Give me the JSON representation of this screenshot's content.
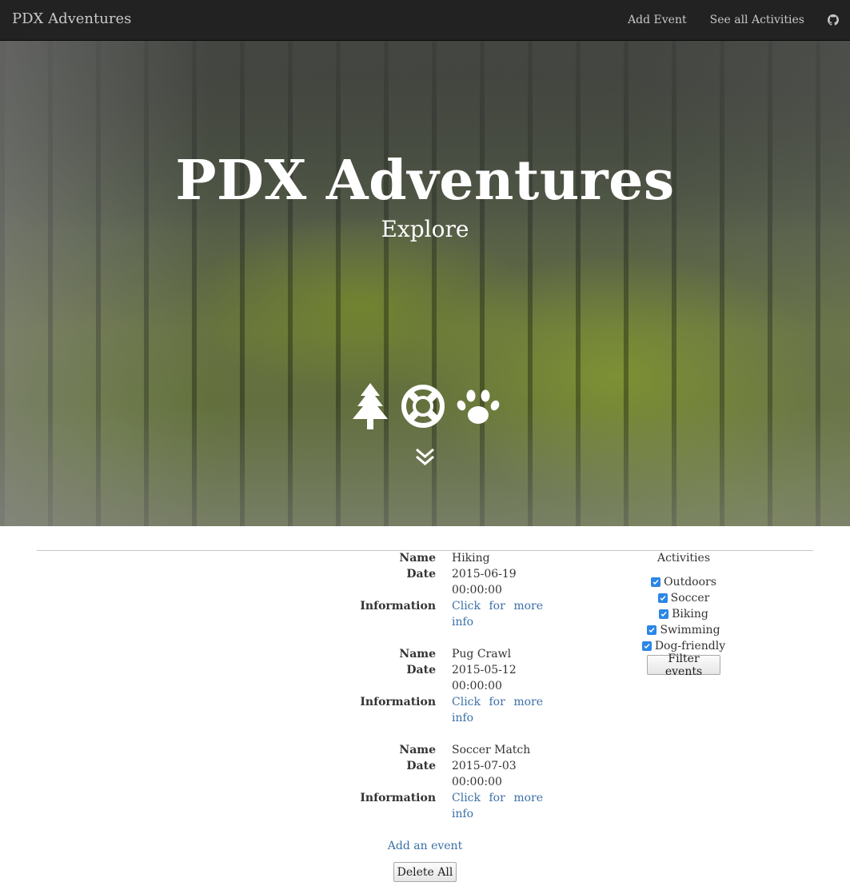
{
  "navbar": {
    "brand": "PDX Adventures",
    "links": [
      "Add Event",
      "See all Activities"
    ],
    "github_icon": "github-icon"
  },
  "hero": {
    "title": "PDX Adventures",
    "subtitle": "Explore",
    "icons": [
      "tree-icon",
      "life-ring-icon",
      "paw-icon"
    ],
    "scroll_icon": "double-chevron-down-icon"
  },
  "labels": {
    "name": "Name",
    "date": "Date",
    "information": "Information"
  },
  "events": [
    {
      "name": "Hiking",
      "date": "2015-06-19",
      "time": "00:00:00",
      "info": [
        "Click",
        "for",
        "more",
        "info"
      ]
    },
    {
      "name": "Pug Crawl",
      "date": "2015-05-12",
      "time": "00:00:00",
      "info": [
        "Click",
        "for",
        "more",
        "info"
      ]
    },
    {
      "name": "Soccer Match",
      "date": "2015-07-03",
      "time": "00:00:00",
      "info": [
        "Click",
        "for",
        "more",
        "info"
      ]
    }
  ],
  "activities": {
    "title": "Activities",
    "options": [
      {
        "label": "Outdoors",
        "checked": true
      },
      {
        "label": "Soccer",
        "checked": true
      },
      {
        "label": "Biking",
        "checked": true
      },
      {
        "label": "Swimming",
        "checked": true
      },
      {
        "label": "Dog-friendly",
        "checked": true
      }
    ],
    "filter_button": "Filter events"
  },
  "footer": {
    "add_link": "Add an event",
    "delete_button": "Delete All"
  },
  "colors": {
    "navbar": "#222222",
    "link": "#3a6fa6",
    "checkbox": "#2b86e6"
  }
}
